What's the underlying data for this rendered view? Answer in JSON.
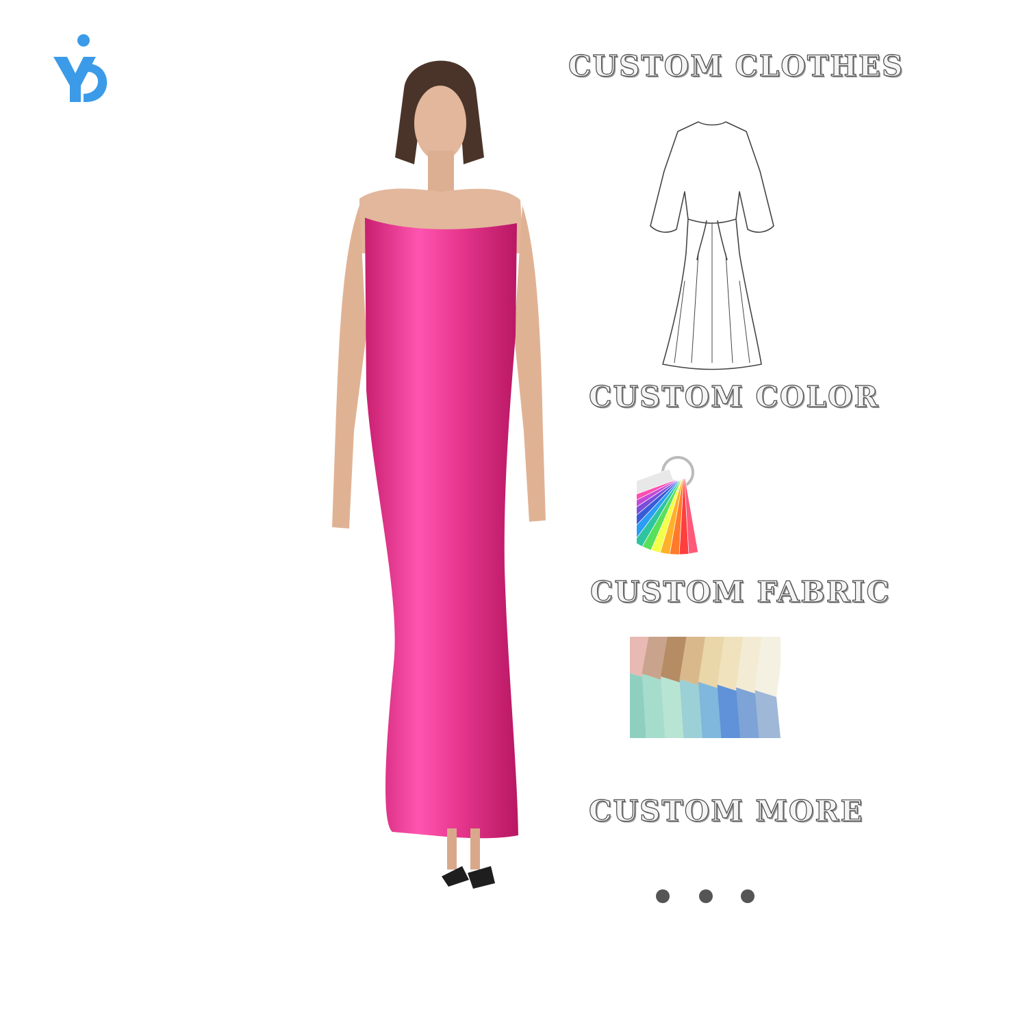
{
  "brand": {
    "logo_icon": "brand-logo-icon",
    "accent": "#3b9be8"
  },
  "sections": [
    {
      "id": "clothes",
      "title": "CUSTOM CLOTHES"
    },
    {
      "id": "color",
      "title": "CUSTOM COLOR"
    },
    {
      "id": "fabric",
      "title": "CUSTOM FABRIC"
    },
    {
      "id": "more",
      "title": "CUSTOM MORE"
    }
  ],
  "product": {
    "dress_color": "#e8388f"
  },
  "swatch_colors": [
    "#ff5a7a",
    "#ff3e3e",
    "#ff7a2a",
    "#ffb02a",
    "#f4ff4a",
    "#59e05a",
    "#2ec4a0",
    "#2a9df4",
    "#3a5bd8",
    "#7a4ed8",
    "#c24ad8",
    "#ff4fb0",
    "#e8e8e8"
  ],
  "fabric_colors": {
    "top": [
      "#e9b9b4",
      "#c9a38c",
      "#b58c63",
      "#d9b98c",
      "#e9d6a9",
      "#efe2bd",
      "#f3ebd3",
      "#f5f1e2"
    ],
    "bottom": [
      "#8fcfc0",
      "#a5dccb",
      "#b8e4d3",
      "#9bd0d6",
      "#7fb7dd",
      "#5f92d8",
      "#7ea3d6",
      "#9fb8d8"
    ]
  }
}
